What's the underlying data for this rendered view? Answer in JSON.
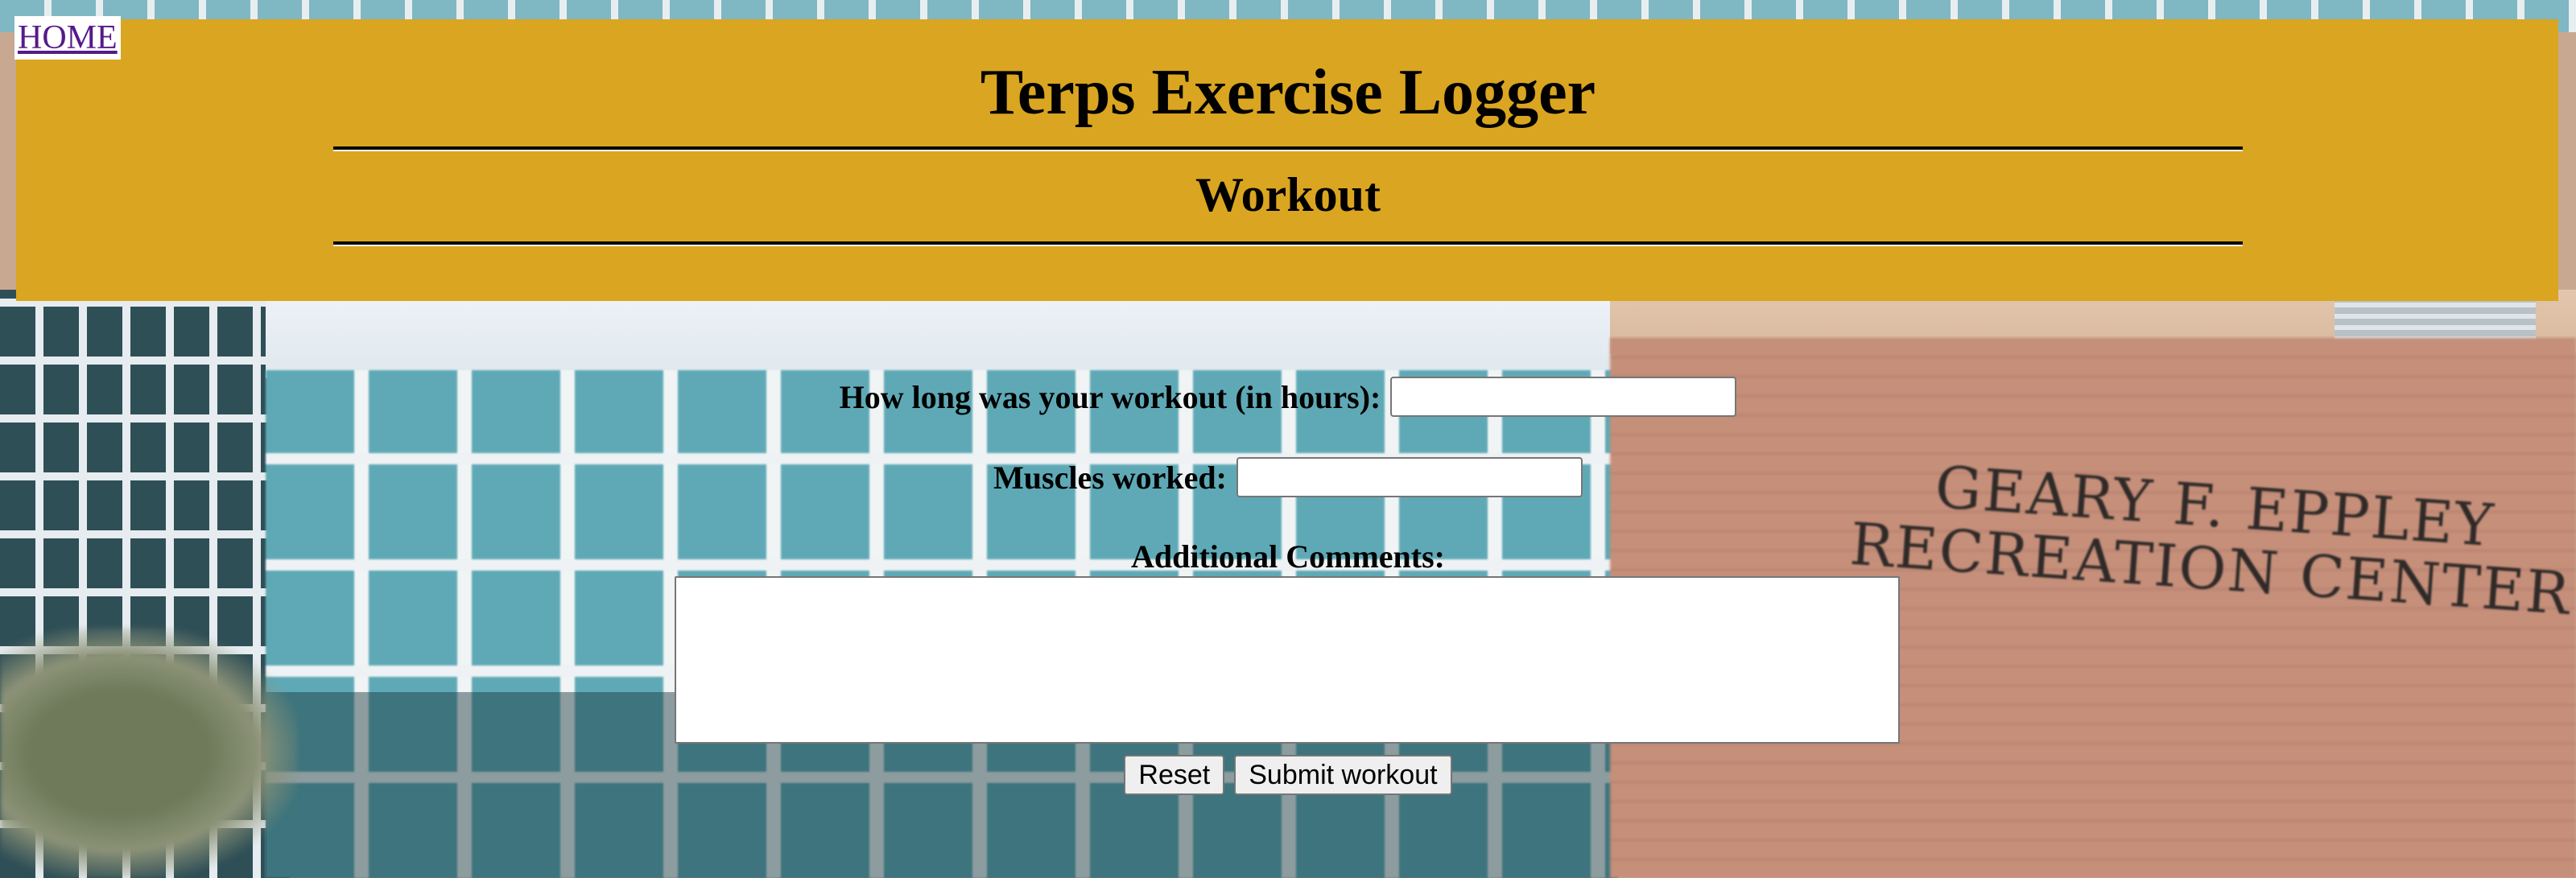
{
  "nav": {
    "home_label": "HOME"
  },
  "header": {
    "title": "Terps Exercise Logger",
    "subtitle": "Workout",
    "band_color": "#daa520"
  },
  "form": {
    "duration_label": "How long was your workout (in hours):",
    "duration_value": "",
    "muscles_label": "Muscles worked:",
    "muscles_value": "",
    "comments_label": "Additional Comments:",
    "comments_value": "",
    "reset_label": "Reset",
    "submit_label": "Submit workout"
  },
  "background": {
    "sign_line1": "GEARY F. EPPLEY",
    "sign_line2": "RECREATION CENTER"
  }
}
